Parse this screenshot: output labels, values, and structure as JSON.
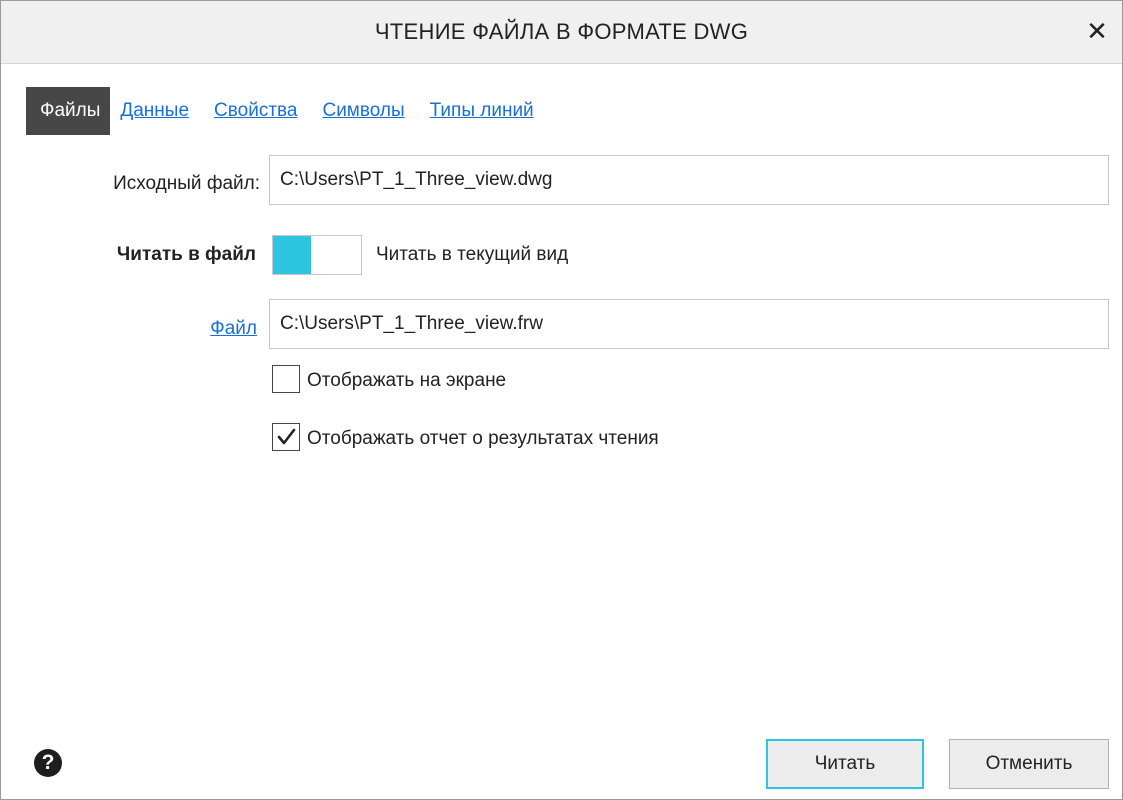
{
  "window": {
    "title": "ЧТЕНИЕ ФАЙЛА В ФОРМАТЕ DWG",
    "close_glyph": "✕"
  },
  "tabs": [
    {
      "label": "Файлы",
      "active": true
    },
    {
      "label": "Данные",
      "active": false
    },
    {
      "label": "Свойства",
      "active": false
    },
    {
      "label": "Символы",
      "active": false
    },
    {
      "label": "Типы линий",
      "active": false
    }
  ],
  "source_file": {
    "label": "Исходный файл:",
    "value": "C:\\Users\\PT_1_Three_view.dwg"
  },
  "read_mode": {
    "left_label": "Читать в файл",
    "right_label": "Читать в текущий вид",
    "state": "left",
    "accent_color": "#2ec5e0"
  },
  "target_file": {
    "link_label": "Файл",
    "value": "C:\\Users\\PT_1_Three_view.frw"
  },
  "options": [
    {
      "label": "Отображать на экране",
      "checked": false
    },
    {
      "label": "Отображать отчет о результатах чтения",
      "checked": true
    }
  ],
  "footer": {
    "help_glyph": "?",
    "read_button": "Читать",
    "cancel_button": "Отменить"
  },
  "colors": {
    "link": "#1a6fd6",
    "active_tab_bg": "#474747",
    "accent": "#2ec5e0"
  }
}
